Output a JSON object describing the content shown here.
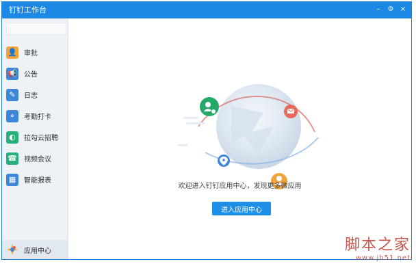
{
  "window": {
    "title": "钉钉工作台",
    "buttons": [
      {
        "name": "minimize",
        "glyph": "–"
      },
      {
        "name": "settings",
        "glyph": "⚙"
      },
      {
        "name": "close",
        "glyph": "×"
      }
    ]
  },
  "sidebar": {
    "items": [
      {
        "label": "审批",
        "icon": "approval-icon",
        "color": "#f2a33a",
        "glyph": "👤"
      },
      {
        "label": "公告",
        "icon": "announcement-icon",
        "color": "#3e86d8",
        "glyph": "📢"
      },
      {
        "label": "日志",
        "icon": "log-icon",
        "color": "#3e86d8",
        "glyph": "✎"
      },
      {
        "label": "考勤打卡",
        "icon": "attendance-icon",
        "color": "#3e86d8",
        "glyph": "⌖"
      },
      {
        "label": "拉勾云招聘",
        "icon": "recruit-icon",
        "color": "#26b07a",
        "glyph": "◐"
      },
      {
        "label": "视频会议",
        "icon": "video-meeting-icon",
        "color": "#26b07a",
        "glyph": "☎"
      },
      {
        "label": "智能报表",
        "icon": "report-icon",
        "color": "#3e86d8",
        "glyph": "▦"
      }
    ],
    "bottom": {
      "label": "应用中心",
      "icon": "app-center-icon"
    }
  },
  "main": {
    "caption": "欢迎进入钉钉应用中心，发现更多微应用",
    "cta": "进入应用中心"
  },
  "watermark": {
    "line1": "脚本之家",
    "line2": "www.jb51.net"
  }
}
